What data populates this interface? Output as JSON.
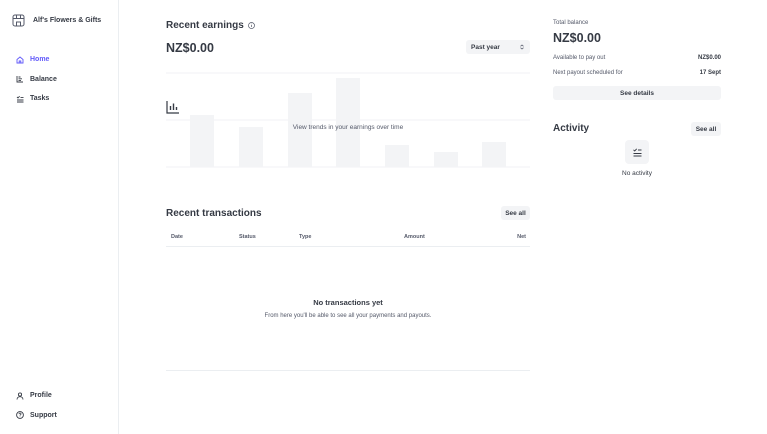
{
  "sidebar": {
    "account_name": "Alf's Flowers & Gifts",
    "nav": [
      {
        "label": "Home",
        "icon": "home-icon",
        "active": true
      },
      {
        "label": "Balance",
        "icon": "balance-icon"
      },
      {
        "label": "Tasks",
        "icon": "tasks-icon"
      }
    ],
    "bottom_nav": [
      {
        "label": "Profile",
        "icon": "person-icon"
      },
      {
        "label": "Support",
        "icon": "help-icon"
      }
    ]
  },
  "earnings": {
    "title": "Recent earnings",
    "value": "NZ$0.00",
    "period": "Past year",
    "empty_caption": "View trends in your earnings over time"
  },
  "transactions": {
    "title": "Recent transactions",
    "see_all": "See all",
    "columns": [
      "Date",
      "Status",
      "Type",
      "Amount",
      "Net"
    ],
    "empty_title": "No transactions yet",
    "empty_subtitle": "From here you'll be able to see all your payments and payouts."
  },
  "balance": {
    "label": "Total balance",
    "value": "NZ$0.00",
    "available_label": "Available to pay out",
    "available_value": "NZ$0.00",
    "next_payout_label": "Next payout scheduled for",
    "next_payout_value": "17 Sept",
    "see_details": "See details"
  },
  "activity": {
    "title": "Activity",
    "see_all": "See all",
    "empty": "No activity"
  },
  "colors": {
    "accent": "#625afa",
    "text": "#353a44",
    "muted": "#545969",
    "placeholder_bar": "#f3f4f6"
  }
}
